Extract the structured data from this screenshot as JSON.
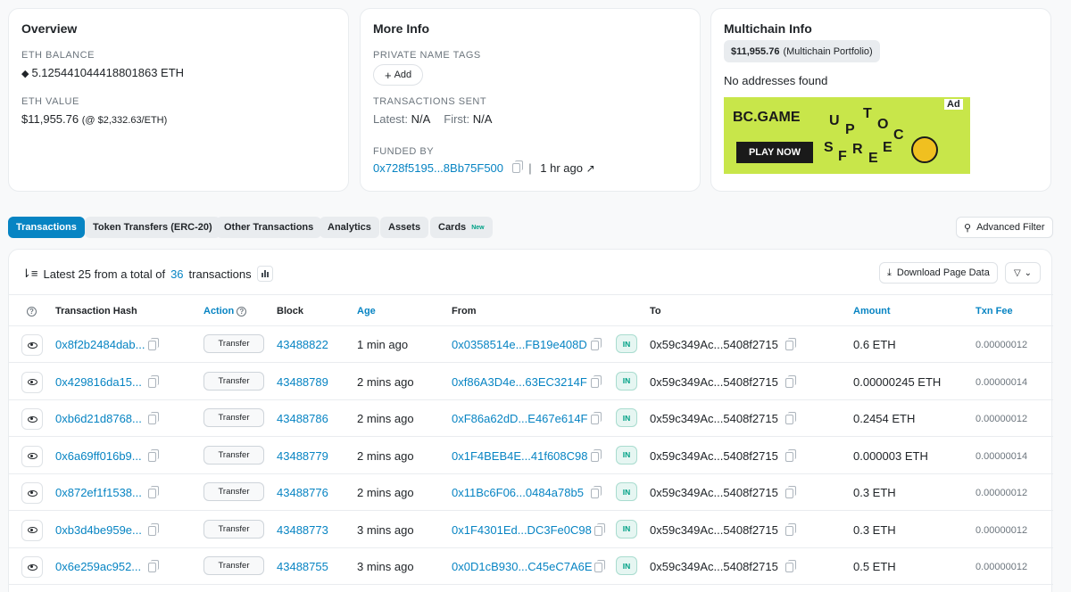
{
  "overview": {
    "title": "Overview",
    "eth_balance_label": "ETH BALANCE",
    "eth_balance": "5.125441044418801863 ETH",
    "eth_value_label": "ETH VALUE",
    "eth_value": "$11,955.76",
    "eth_price": "(@ $2,332.63/ETH)"
  },
  "more_info": {
    "title": "More Info",
    "private_tags_label": "PRIVATE NAME TAGS",
    "add_label": "Add",
    "tx_sent_label": "TRANSACTIONS SENT",
    "latest_label": "Latest:",
    "latest_value": "N/A",
    "first_label": "First:",
    "first_value": "N/A",
    "funded_by_label": "FUNDED BY",
    "funded_by_address": "0x728f5195...8Bb75F500",
    "funded_by_age": "1 hr ago"
  },
  "multichain": {
    "title": "Multichain Info",
    "portfolio_value": "$11,955.76",
    "portfolio_label": "(Multichain Portfolio)",
    "no_addresses": "No addresses found",
    "ad_tag": "Ad",
    "ad_brand": "BC.GAME",
    "ad_cta": "PLAY NOW",
    "ad_art_text": [
      "U",
      "P",
      "T",
      "O",
      "C",
      "S",
      "F",
      "R",
      "E",
      "E"
    ]
  },
  "tabs": [
    {
      "label": "Transactions",
      "active": true
    },
    {
      "label": "Token Transfers (ERC-20)"
    },
    {
      "label": "Other Transactions"
    },
    {
      "label": "Analytics"
    },
    {
      "label": "Assets"
    },
    {
      "label": "Cards",
      "badge": "New"
    }
  ],
  "advanced_filter_label": "Advanced Filter",
  "table": {
    "summary_prefix": "Latest 25 from a total of",
    "total_count": "36",
    "summary_suffix": "transactions",
    "download_label": "Download Page Data",
    "headers": {
      "hash": "Transaction Hash",
      "action": "Action",
      "block": "Block",
      "age": "Age",
      "from": "From",
      "to": "To",
      "amount": "Amount",
      "fee": "Txn Fee"
    },
    "rows": [
      {
        "hash": "0x8f2b2484dab...",
        "action": "Transfer",
        "block": "43488822",
        "age": "1 min ago",
        "from": "0x0358514e...FB19e408D",
        "direction": "IN",
        "to": "0x59c349Ac...5408f2715",
        "amount": "0.6 ETH",
        "fee": "0.00000012"
      },
      {
        "hash": "0x429816da15...",
        "action": "Transfer",
        "block": "43488789",
        "age": "2 mins ago",
        "from": "0xf86A3D4e...63EC3214F",
        "direction": "IN",
        "to": "0x59c349Ac...5408f2715",
        "amount": "0.00000245 ETH",
        "fee": "0.00000014"
      },
      {
        "hash": "0xb6d21d8768...",
        "action": "Transfer",
        "block": "43488786",
        "age": "2 mins ago",
        "from": "0xF86a62dD...E467e614F",
        "direction": "IN",
        "to": "0x59c349Ac...5408f2715",
        "amount": "0.2454 ETH",
        "fee": "0.00000012"
      },
      {
        "hash": "0x6a69ff016b9...",
        "action": "Transfer",
        "block": "43488779",
        "age": "2 mins ago",
        "from": "0x1F4BEB4E...41f608C98",
        "direction": "IN",
        "to": "0x59c349Ac...5408f2715",
        "amount": "0.000003 ETH",
        "fee": "0.00000014"
      },
      {
        "hash": "0x872ef1f1538...",
        "action": "Transfer",
        "block": "43488776",
        "age": "2 mins ago",
        "from": "0x11Bc6F06...0484a78b5",
        "direction": "IN",
        "to": "0x59c349Ac...5408f2715",
        "amount": "0.3 ETH",
        "fee": "0.00000012"
      },
      {
        "hash": "0xb3d4be959e...",
        "action": "Transfer",
        "block": "43488773",
        "age": "3 mins ago",
        "from": "0x1F4301Ed...DC3Fe0C98",
        "direction": "IN",
        "to": "0x59c349Ac...5408f2715",
        "amount": "0.3 ETH",
        "fee": "0.00000012"
      },
      {
        "hash": "0x6e259ac952...",
        "action": "Transfer",
        "block": "43488755",
        "age": "3 mins ago",
        "from": "0x0D1cB930...C45eC7A6E",
        "direction": "IN",
        "to": "0x59c349Ac...5408f2715",
        "amount": "0.5 ETH",
        "fee": "0.00000012"
      }
    ]
  }
}
